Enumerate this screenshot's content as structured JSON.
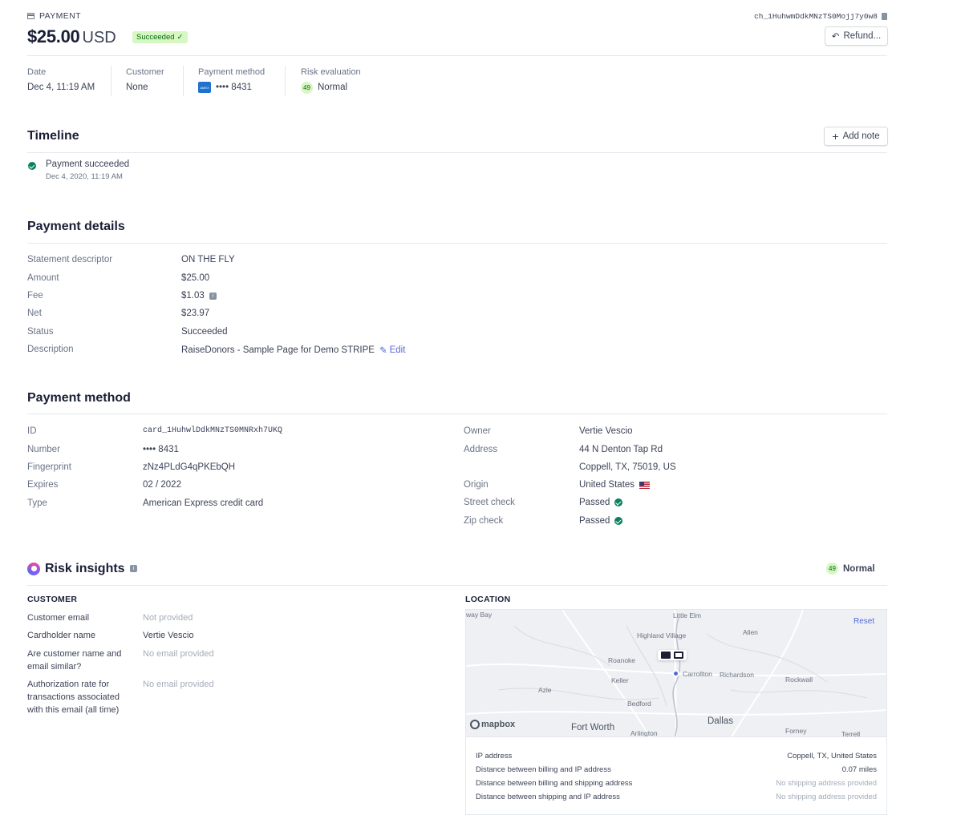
{
  "header": {
    "label": "PAYMENT",
    "charge_id": "ch_1HuhwmDdkMNzTS0Mojj7y0w8",
    "amount": "$25.00",
    "currency": "USD",
    "status_badge": "Succeeded",
    "refund_button": "Refund..."
  },
  "summary": {
    "date_label": "Date",
    "date_value": "Dec 4, 11:19 AM",
    "customer_label": "Customer",
    "customer_value": "None",
    "method_label": "Payment method",
    "method_value": "•••• 8431",
    "risk_label": "Risk evaluation",
    "risk_score": "49",
    "risk_value": "Normal"
  },
  "timeline": {
    "title": "Timeline",
    "add_note": "Add note",
    "event_title": "Payment succeeded",
    "event_time": "Dec 4, 2020, 11:19 AM"
  },
  "payment_details": {
    "title": "Payment details",
    "rows": [
      {
        "label": "Statement descriptor",
        "value": "ON THE FLY"
      },
      {
        "label": "Amount",
        "value": "$25.00"
      },
      {
        "label": "Fee",
        "value": "$1.03"
      },
      {
        "label": "Net",
        "value": "$23.97"
      },
      {
        "label": "Status",
        "value": "Succeeded"
      },
      {
        "label": "Description",
        "value": "RaiseDonors - Sample Page for Demo STRIPE"
      }
    ],
    "edit_label": "Edit"
  },
  "payment_method": {
    "title": "Payment method",
    "left": [
      {
        "label": "ID",
        "value": "card_1HuhwlDdkMNzTS0MNRxh7UKQ"
      },
      {
        "label": "Number",
        "value": "•••• 8431"
      },
      {
        "label": "Fingerprint",
        "value": "zNz4PLdG4qPKEbQH"
      },
      {
        "label": "Expires",
        "value": "02 / 2022"
      },
      {
        "label": "Type",
        "value": "American Express credit card"
      }
    ],
    "right": {
      "owner_label": "Owner",
      "owner_value": "Vertie Vescio",
      "address_label": "Address",
      "address_line1": "44 N Denton Tap Rd",
      "address_line2": "Coppell, TX, 75019, US",
      "origin_label": "Origin",
      "origin_value": "United States",
      "street_label": "Street check",
      "street_value": "Passed",
      "zip_label": "Zip check",
      "zip_value": "Passed"
    }
  },
  "risk": {
    "title": "Risk insights",
    "score": "49",
    "level": "Normal",
    "customer_caption": "CUSTOMER",
    "location_caption": "LOCATION",
    "customer_rows": [
      {
        "label": "Customer email",
        "value": "Not provided"
      },
      {
        "label": "Cardholder name",
        "value": "Vertie Vescio"
      },
      {
        "label": "Are customer name and email similar?",
        "value": "No email provided"
      },
      {
        "label": "Authorization rate for transactions associated with this email (all time)",
        "value": "No email provided"
      }
    ],
    "map": {
      "reset": "Reset",
      "attribution": "mapbox",
      "cities": [
        "Little Elm",
        "Highland Village",
        "Allen",
        "Roanoke",
        "Carrollton",
        "Richardson",
        "Keller",
        "Rockwall",
        "Azle",
        "Bedford",
        "Fort Worth",
        "Dallas",
        "Arlington",
        "Forney",
        "Terrell",
        "way Bay"
      ]
    },
    "ip_rows": [
      {
        "label": "IP address",
        "value": "Coppell, TX, United States"
      },
      {
        "label": "Distance between billing and IP address",
        "value": "0.07 miles"
      },
      {
        "label": "Distance between billing and shipping address",
        "value": "No shipping address provided"
      },
      {
        "label": "Distance between shipping and IP address",
        "value": "No shipping address provided"
      }
    ]
  },
  "colors": {
    "success_bg": "#d7f7c2",
    "success_text": "#05690d",
    "link": "#5469d4",
    "check_green": "#09825d"
  }
}
